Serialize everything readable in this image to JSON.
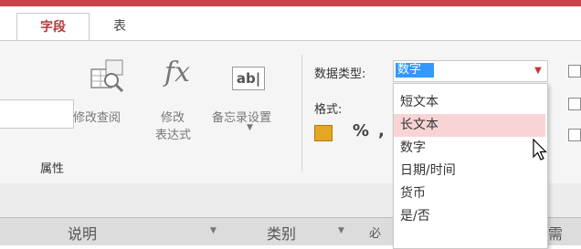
{
  "tabs": {
    "fields": "字段",
    "table": "表"
  },
  "ribbon": {
    "modify_lookup": "修改查阅",
    "modify_expression": "修改\n表达式",
    "modify_expression_line1": "修改",
    "modify_expression_line2": "表达式",
    "memo_settings": "备忘录设置",
    "memo_icon_text": "ab|",
    "fx": "fx",
    "data_type_label": "数据类型:",
    "data_type_value": "数字",
    "format_label": "格式:",
    "percent": "%",
    "comma": ",",
    "group_label": "属性"
  },
  "dropdown": {
    "options": [
      "短文本",
      "长文本",
      "数字",
      "日期/时间",
      "货币",
      "是/否"
    ],
    "highlighted": "长文本"
  },
  "table_header": {
    "col1": "说明",
    "col2": "类别",
    "col3_partial": "必",
    "col4_partial": "需"
  },
  "colors": {
    "accent": "#c8444a",
    "selection": "#3399ff",
    "hover": "#f8d4d7"
  }
}
